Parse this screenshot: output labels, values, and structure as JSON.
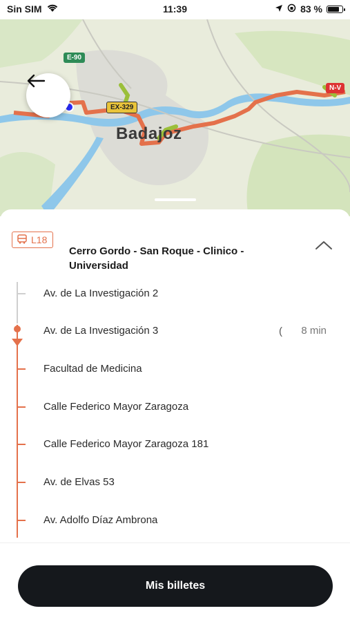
{
  "status_bar": {
    "carrier": "Sin SIM",
    "time": "11:39",
    "battery": "83 %",
    "battery_level": 0.83
  },
  "map": {
    "city_label": "Badajoz",
    "shields": {
      "e90": "E-90",
      "ex329": "EX-329",
      "nv": "N-V"
    },
    "colors": {
      "route": "#e4714b",
      "river": "#8ec7ea",
      "park": "#c8e0a8"
    }
  },
  "route": {
    "line_code": "L18",
    "name": "Cerro Gordo - San Roque - Clinico - Universidad"
  },
  "stops": [
    {
      "name": "Av. de La Investigación 2",
      "eta": ""
    },
    {
      "name": "Av. de La Investigación 3",
      "eta": "8 min"
    },
    {
      "name": "Facultad de Medicina",
      "eta": ""
    },
    {
      "name": "Calle Federico Mayor Zaragoza",
      "eta": ""
    },
    {
      "name": "Calle Federico Mayor Zaragoza  181",
      "eta": ""
    },
    {
      "name": "Av. de Elvas  53",
      "eta": ""
    },
    {
      "name": "Av. Adolfo Díaz Ambrona",
      "eta": ""
    }
  ],
  "cta": {
    "label": "Mis billetes"
  }
}
